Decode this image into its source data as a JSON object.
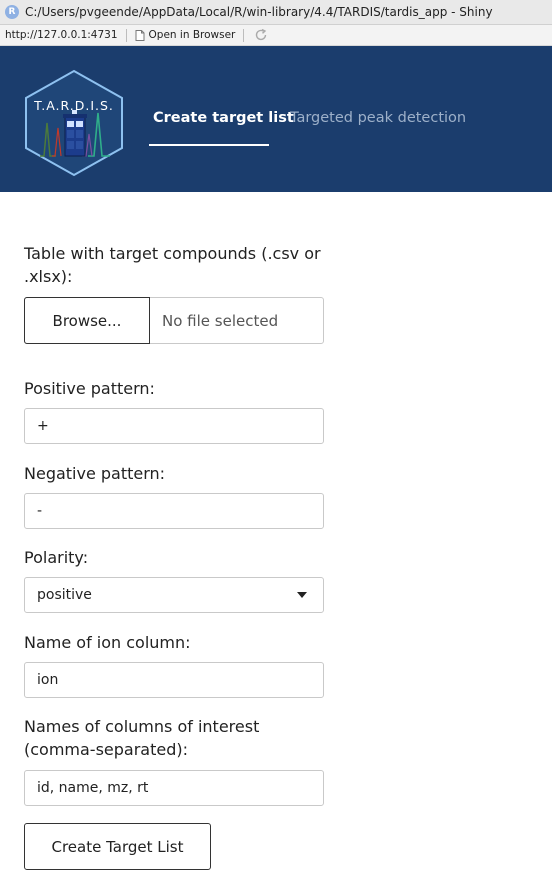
{
  "window": {
    "app_icon_letter": "R",
    "title": "C:/Users/pvgeende/AppData/Local/R/win-library/4.4/TARDIS/tardis_app - Shiny"
  },
  "address_bar": {
    "url": "http://127.0.0.1:4731",
    "open_in_browser_label": "Open in Browser"
  },
  "navbar": {
    "logo_text": "T.A.R.D.I.S.",
    "tabs": [
      {
        "label": "Create target list",
        "active": true
      },
      {
        "label": "Targeted peak detection",
        "active": false
      }
    ],
    "colors": {
      "background": "#1b3d6d",
      "inactive_tab": "#9db0c9"
    }
  },
  "form": {
    "file_label": "Table with target compounds (.csv or .xlsx):",
    "browse_label": "Browse...",
    "file_status": "No file selected",
    "positive_label": "Positive pattern:",
    "positive_value": "+",
    "negative_label": "Negative pattern:",
    "negative_value": "-",
    "polarity_label": "Polarity:",
    "polarity_value": "positive",
    "ion_column_label": "Name of ion column:",
    "ion_column_value": "ion",
    "columns_label": "Names of columns of interest (comma-separated):",
    "columns_value": "id, name, mz, rt",
    "create_button_label": "Create Target List"
  }
}
